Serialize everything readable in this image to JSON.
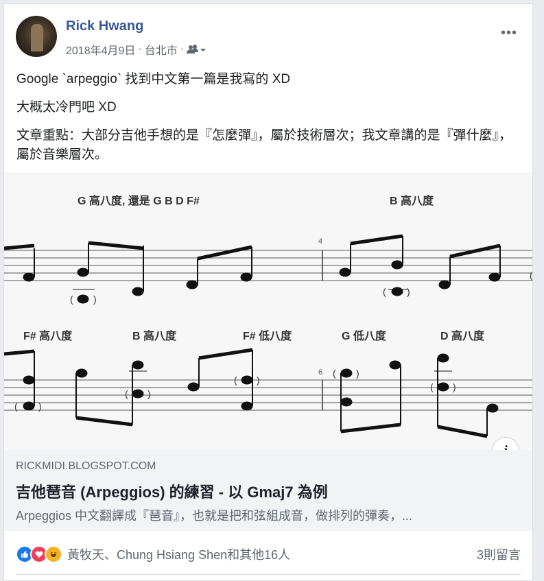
{
  "post": {
    "author": "Rick Hwang",
    "date": "2018年4月9日",
    "sep1": "·",
    "location": "台北市",
    "sep2": "·",
    "audience_icon": "friends-icon",
    "more": "•••",
    "lines": [
      "Google `arpeggio` 找到中文第一篇是我寫的 XD",
      "大概太冷門吧 XD",
      "文章重點：大部分吉他手想的是『怎麼彈』，屬於技術層次；我文章講的是『彈什麼』，屬於音樂層次。"
    ]
  },
  "sheet": {
    "labels_row1": [
      "G 高八度, 還是 G B D F#",
      "B 高八度"
    ],
    "labels_row2": [
      "F# 高八度",
      "B 高八度",
      "F# 低八度",
      "G 低八度",
      "D 高八度"
    ],
    "measure_numbers": [
      "4",
      "6"
    ],
    "paren_open": "(",
    "paren_close": ")"
  },
  "link": {
    "domain": "RICKMIDI.BLOGSPOT.COM",
    "title": "吉他琶音 (Arpeggios) 的練習 - 以 Gmaj7 為例",
    "description": "Arpeggios 中文翻譯成『琶音』，也就是把和弦組成音，做排列的彈奏，...",
    "info": "i"
  },
  "footer": {
    "reactions": [
      "like",
      "love",
      "haha"
    ],
    "reaction_text": "黃牧天、Chung Hsiang Shen和其他16人",
    "comments": "3則留言"
  }
}
